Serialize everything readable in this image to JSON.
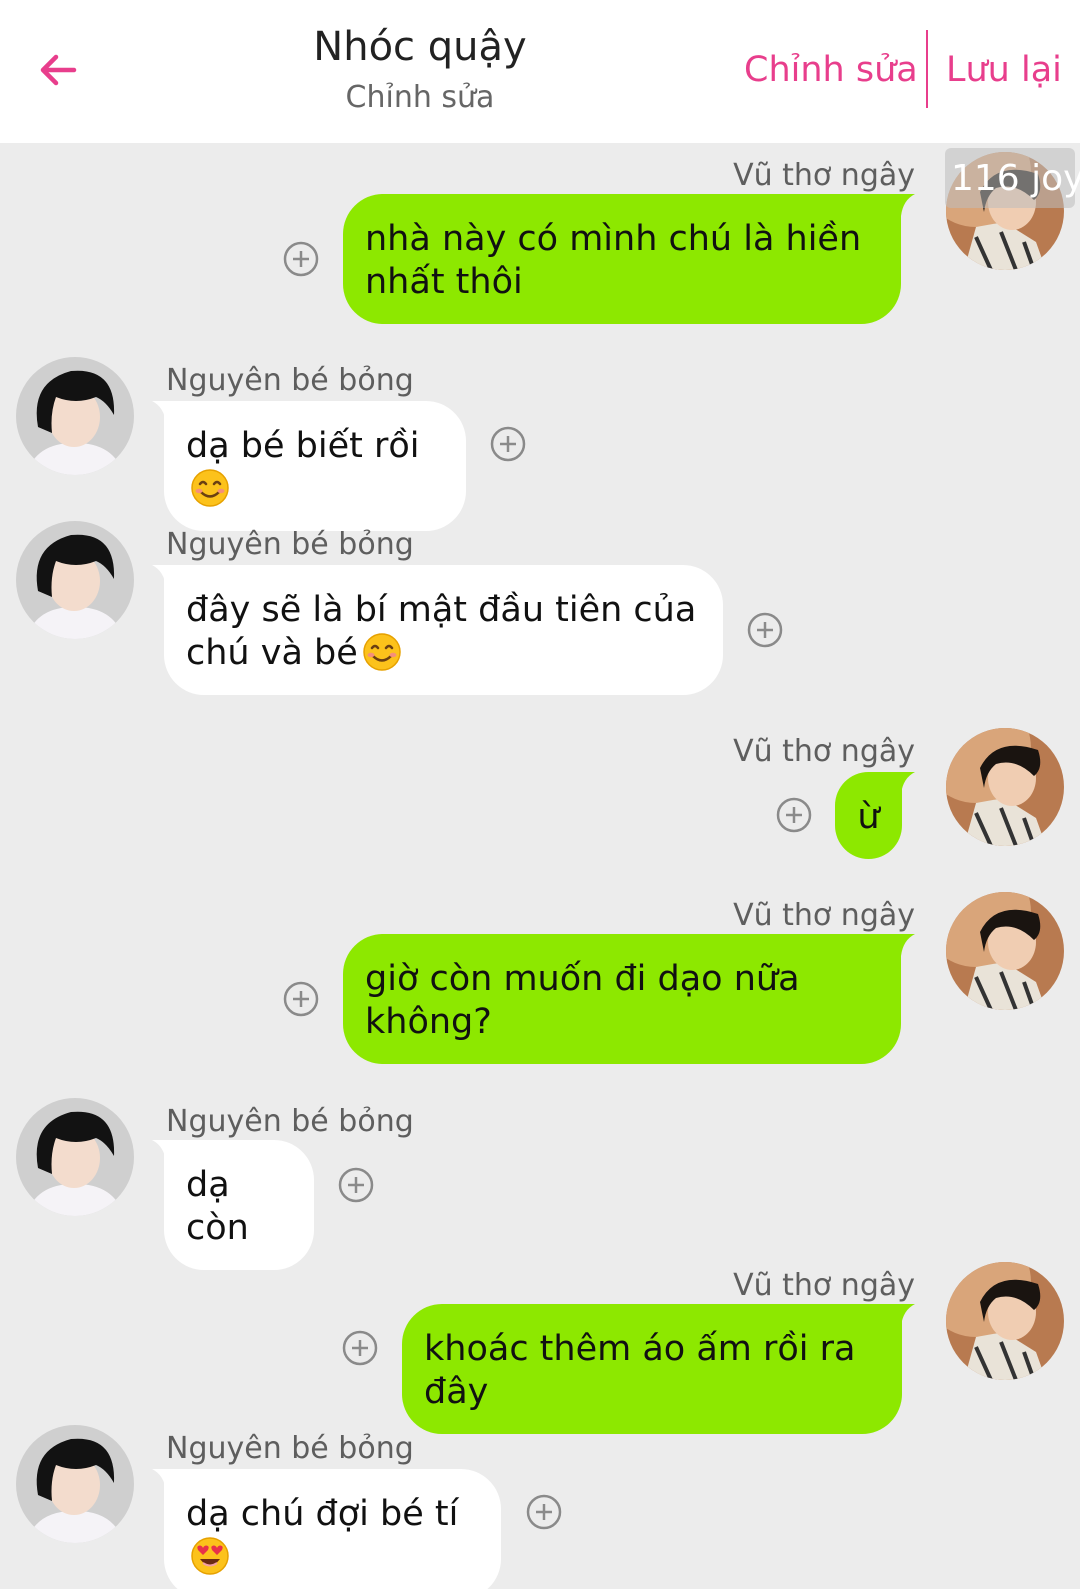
{
  "header": {
    "title": "Nhóc quậy",
    "subtitle": "Chỉnh sửa",
    "edit_label": "Chỉnh sửa",
    "save_label": "Lưu lại",
    "accent_color": "#e83e8c"
  },
  "badge": {
    "text": "116 joy"
  },
  "messages": [
    {
      "side": "right",
      "sender": "Vũ thơ ngây",
      "lines": [
        "nhà này có mình chú là hiền",
        "nhất thôi"
      ]
    },
    {
      "side": "left",
      "sender": "Nguyên bé bỏng",
      "lines": [
        "dạ bé biết rồi"
      ],
      "emoji": "smiling-face"
    },
    {
      "side": "left",
      "sender": "Nguyên bé bỏng",
      "lines": [
        "đây sẽ là bí mật đầu tiên của",
        "chú và bé"
      ],
      "emoji": "smiling-face"
    },
    {
      "side": "right",
      "sender": "Vũ thơ ngây",
      "lines": [
        "ừ"
      ]
    },
    {
      "side": "right",
      "sender": "Vũ thơ ngây",
      "lines": [
        "giờ còn muốn đi dạo nữa",
        "không?"
      ]
    },
    {
      "side": "left",
      "sender": "Nguyên bé bỏng",
      "lines": [
        "dạ còn"
      ]
    },
    {
      "side": "right",
      "sender": "Vũ thơ ngây",
      "lines": [
        "khoác thêm áo ấm rồi ra đây"
      ]
    },
    {
      "side": "left",
      "sender": "Nguyên bé bỏng",
      "lines": [
        "dạ chú đợi bé tí"
      ],
      "emoji": "heart-eyes-face"
    }
  ],
  "colors": {
    "background": "#ececec",
    "bubble_right": "#8de800",
    "bubble_left": "#ffffff"
  }
}
